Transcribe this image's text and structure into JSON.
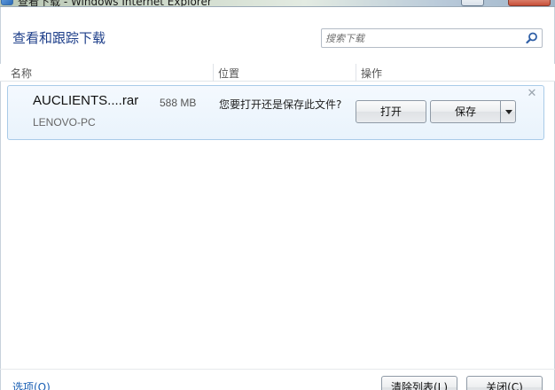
{
  "window": {
    "title": "查看下载 - Windows Internet Explorer"
  },
  "header": {
    "title": "查看和跟踪下载",
    "search_placeholder": "搜索下载"
  },
  "columns": [
    "名称",
    "位置",
    "操作"
  ],
  "download": {
    "file_name": "AUCLIENTS....rar",
    "size": "588 MB",
    "source": "LENOVO-PC",
    "prompt": "您要打开还是保存此文件?",
    "open_label": "打开",
    "save_label": "保存"
  },
  "footer": {
    "options_label": "选项(O)",
    "clear_list_label": "清除列表(L)",
    "close_label": "关闭(C)"
  },
  "colors": {
    "title": "#1e3f8a",
    "link": "#1a5fb4",
    "row_border": "#a9cbe8",
    "row_bg": "#eaf3fc"
  }
}
